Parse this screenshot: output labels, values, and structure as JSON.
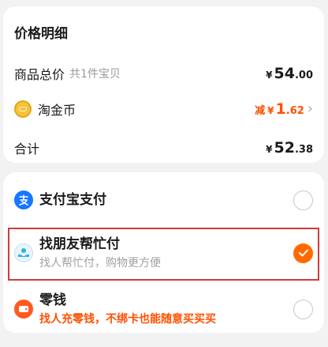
{
  "price_details": {
    "title": "价格明细",
    "goods_total": {
      "label": "商品总价",
      "sub": "共1件宝贝",
      "currency": "¥",
      "int": "54",
      "dec": ".00"
    },
    "taojinbi": {
      "label": "淘金币",
      "reduce": "减",
      "currency": "¥",
      "int": "1",
      "dec": ".62"
    },
    "total": {
      "label": "合计",
      "currency": "¥",
      "int": "52",
      "dec": ".38"
    }
  },
  "payment_methods": [
    {
      "name": "支付宝支付",
      "icon": "alipay-icon",
      "selected": false
    },
    {
      "name": "找朋友帮忙付",
      "desc": "找人帮忙付，购物更方便",
      "icon": "friend-pay-icon",
      "selected": true
    },
    {
      "name": "零钱",
      "desc": "找人充零钱，不绑卡也能随意买买买",
      "icon": "wallet-icon",
      "selected": false
    }
  ],
  "colors": {
    "accent": "#ff5000",
    "radio_checked": "#ff6a00",
    "highlight": "#d23a3a",
    "alipay": "#1677ff"
  }
}
